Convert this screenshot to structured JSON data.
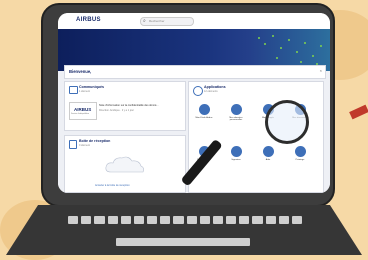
{
  "brand": {
    "logo": "AIRBUS",
    "accent": "#1a2c6b",
    "hero_green": "#7fd34f"
  },
  "search": {
    "placeholder": "Rechercher"
  },
  "welcome": {
    "title": "Bienvenue,",
    "close_glyph": "×"
  },
  "communiques": {
    "title": "Communiqués",
    "subtitle": "1 élément",
    "item_title": "Note d'information sur la confidentialité des donné...",
    "item_meta": "Direction Juridique · il y a 1 jour",
    "item_source": "Direction Juridique Airbus"
  },
  "inbox": {
    "title": "Boîte de réception",
    "subtitle": "0 élément",
    "empty_link": "Accéder à la boîte de réception"
  },
  "applications": {
    "title": "Applications",
    "subtitle": "12 éléments",
    "items": [
      {
        "label": "Mon Flash Airbus"
      },
      {
        "label": "Mes données personnelles"
      },
      {
        "label": "Mes congés"
      },
      {
        "label": "Mes documents"
      },
      {
        "label": "Ma Formation"
      },
      {
        "label": "Signature"
      },
      {
        "label": "Aide"
      },
      {
        "label": "Pointage"
      }
    ]
  }
}
